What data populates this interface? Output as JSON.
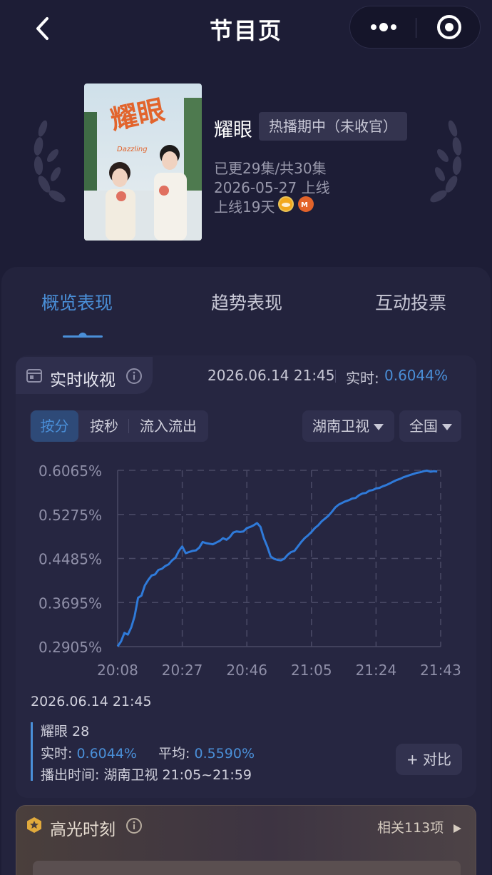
{
  "header": {
    "title": "节目页",
    "back_icon": "chevron-left-icon",
    "more_icon": "more-dots-icon",
    "target_icon": "target-icon"
  },
  "show": {
    "name": "耀眼",
    "status": "热播期中（未收官）",
    "episodes": "已更29集/共30集",
    "premiere": "2026-05-27 上线",
    "days_online": "上线19天",
    "poster_title": "耀眼",
    "poster_subtitle": "Dazzling",
    "platforms": [
      "mango-tv-orange-icon",
      "mgtv-icon"
    ]
  },
  "tabs": [
    {
      "label": "概览表现",
      "active": true
    },
    {
      "label": "趋势表现",
      "active": false
    },
    {
      "label": "互动投票",
      "active": false
    }
  ],
  "realtime": {
    "title": "实时收视",
    "timestamp": "2026.06.14 21:45",
    "label": "实时:",
    "value": "0.6044%"
  },
  "filters": {
    "segments": [
      {
        "label": "按分",
        "active": true
      },
      {
        "label": "按秒",
        "active": false
      },
      {
        "label": "流入流出",
        "active": false
      }
    ],
    "channel": "湖南卫视",
    "region": "全国"
  },
  "chart_data": {
    "type": "line",
    "y_ticks": [
      "0.6065%",
      "0.5275%",
      "0.4485%",
      "0.3695%",
      "0.2905%"
    ],
    "x_ticks": [
      "20:08",
      "20:27",
      "20:46",
      "21:05",
      "21:24",
      "21:43"
    ],
    "ylim": [
      0.2905,
      0.6065
    ],
    "x_range_minutes": [
      0,
      95
    ],
    "grid": true,
    "series": [
      {
        "color": "#2f7ad9",
        "points": [
          [
            0,
            0.291
          ],
          [
            1,
            0.3
          ],
          [
            2,
            0.315
          ],
          [
            3,
            0.312
          ],
          [
            4,
            0.325
          ],
          [
            5,
            0.345
          ],
          [
            6,
            0.378
          ],
          [
            7,
            0.382
          ],
          [
            8,
            0.4
          ],
          [
            9,
            0.41
          ],
          [
            10,
            0.418
          ],
          [
            11,
            0.42
          ],
          [
            12,
            0.428
          ],
          [
            13,
            0.43
          ],
          [
            14,
            0.435
          ],
          [
            15,
            0.438
          ],
          [
            16,
            0.445
          ],
          [
            17,
            0.45
          ],
          [
            18,
            0.462
          ],
          [
            19,
            0.47
          ],
          [
            20,
            0.458
          ],
          [
            21,
            0.46
          ],
          [
            22,
            0.462
          ],
          [
            23,
            0.463
          ],
          [
            24,
            0.468
          ],
          [
            25,
            0.478
          ],
          [
            26,
            0.476
          ],
          [
            27,
            0.475
          ],
          [
            28,
            0.474
          ],
          [
            29,
            0.477
          ],
          [
            30,
            0.48
          ],
          [
            31,
            0.485
          ],
          [
            32,
            0.482
          ],
          [
            33,
            0.487
          ],
          [
            34,
            0.495
          ],
          [
            35,
            0.497
          ],
          [
            36,
            0.496
          ],
          [
            37,
            0.497
          ],
          [
            38,
            0.503
          ],
          [
            39,
            0.505
          ],
          [
            40,
            0.508
          ],
          [
            41,
            0.512
          ],
          [
            42,
            0.505
          ],
          [
            43,
            0.485
          ],
          [
            44,
            0.47
          ],
          [
            45,
            0.452
          ],
          [
            46,
            0.448
          ],
          [
            47,
            0.446
          ],
          [
            48,
            0.445
          ],
          [
            49,
            0.448
          ],
          [
            50,
            0.455
          ],
          [
            51,
            0.46
          ],
          [
            52,
            0.462
          ],
          [
            53,
            0.47
          ],
          [
            54,
            0.478
          ],
          [
            55,
            0.485
          ],
          [
            56,
            0.49
          ],
          [
            57,
            0.496
          ],
          [
            58,
            0.503
          ],
          [
            59,
            0.508
          ],
          [
            60,
            0.515
          ],
          [
            61,
            0.52
          ],
          [
            62,
            0.525
          ],
          [
            63,
            0.532
          ],
          [
            64,
            0.54
          ],
          [
            65,
            0.545
          ],
          [
            66,
            0.548
          ],
          [
            67,
            0.551
          ],
          [
            68,
            0.553
          ],
          [
            69,
            0.556
          ],
          [
            70,
            0.557
          ],
          [
            71,
            0.562
          ],
          [
            72,
            0.565
          ],
          [
            73,
            0.566
          ],
          [
            74,
            0.57
          ],
          [
            75,
            0.571
          ],
          [
            76,
            0.574
          ],
          [
            77,
            0.575
          ],
          [
            78,
            0.578
          ],
          [
            79,
            0.58
          ],
          [
            80,
            0.583
          ],
          [
            81,
            0.586
          ],
          [
            82,
            0.589
          ],
          [
            83,
            0.591
          ],
          [
            84,
            0.594
          ],
          [
            85,
            0.596
          ],
          [
            86,
            0.598
          ],
          [
            87,
            0.6
          ],
          [
            88,
            0.602
          ],
          [
            89,
            0.603
          ],
          [
            90,
            0.605
          ],
          [
            91,
            0.606
          ],
          [
            92,
            0.604
          ],
          [
            93,
            0.605
          ],
          [
            94,
            0.6044
          ]
        ]
      }
    ]
  },
  "tooltip": {
    "time": "2026.06.14 21:45",
    "episode": "耀眼 28",
    "realtime_label": "实时:",
    "realtime_value": "0.6044%",
    "avg_label": "平均:",
    "avg_value": "0.5590%",
    "airtime": "播出时间: 湖南卫视 21:05~21:59"
  },
  "compare_button": "+ 对比",
  "highlights": {
    "title": "高光时刻",
    "related": "相关113项",
    "icon": "star-badge-icon"
  }
}
